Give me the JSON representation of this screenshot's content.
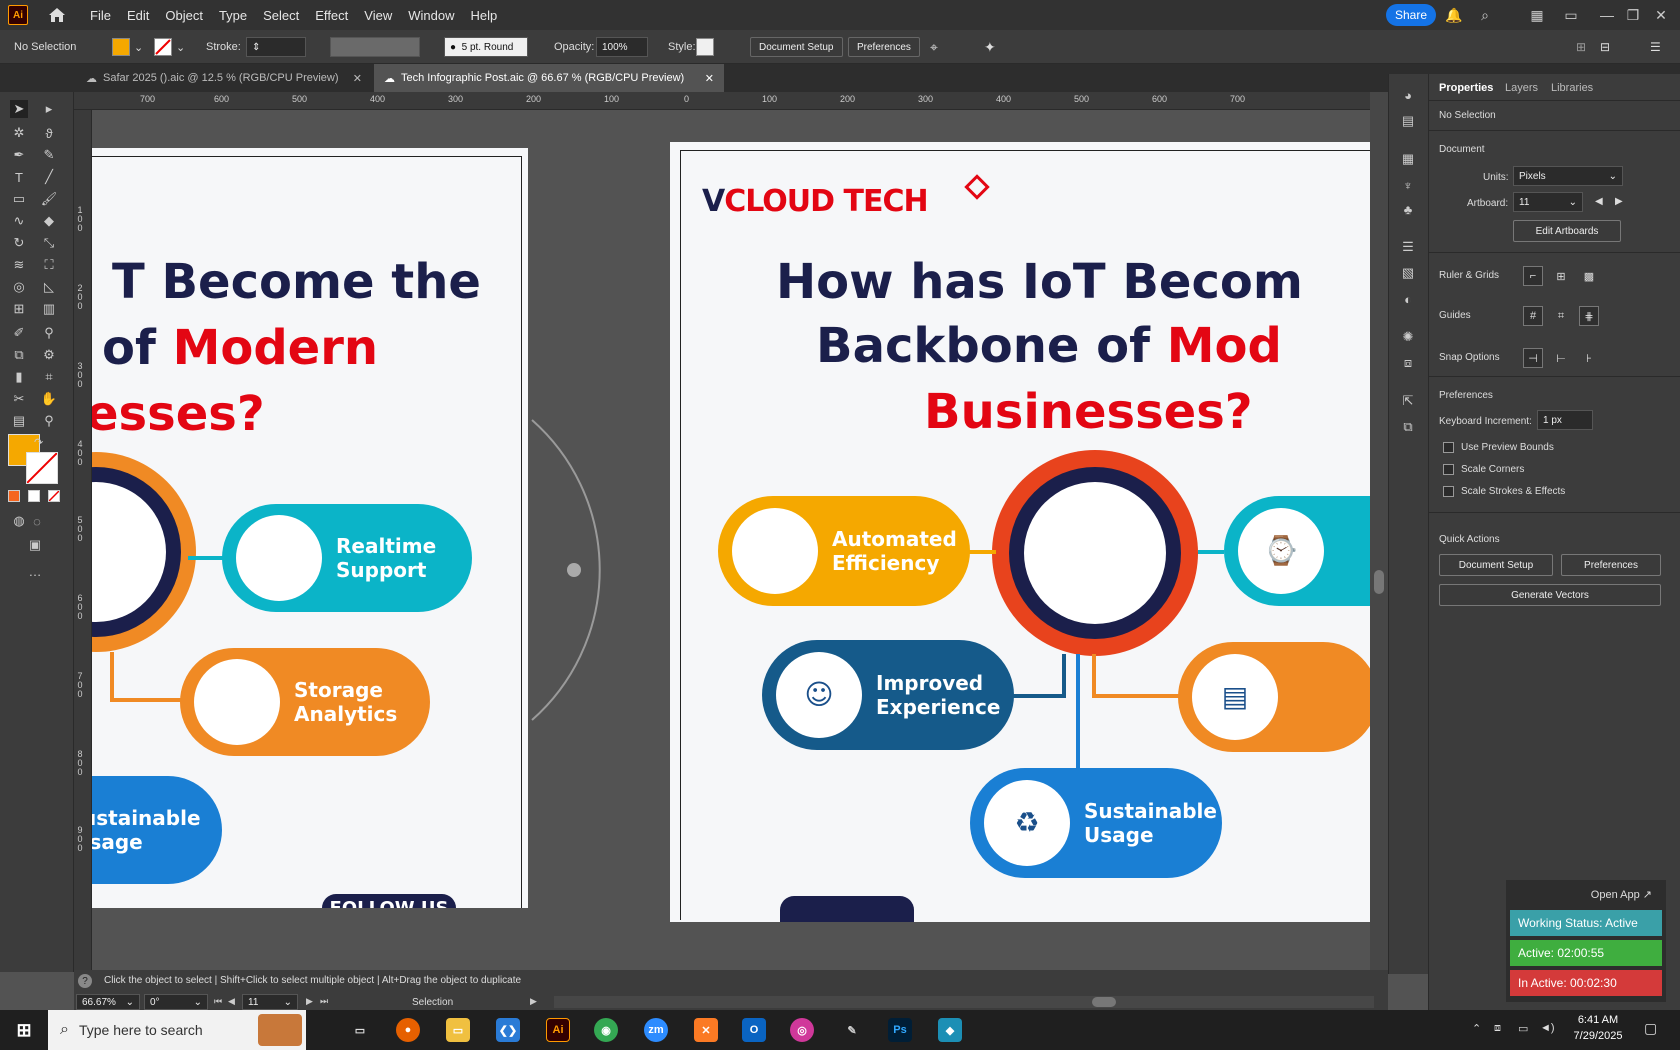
{
  "app": {
    "logo": "Ai",
    "menu": [
      "File",
      "Edit",
      "Object",
      "Type",
      "Select",
      "Effect",
      "View",
      "Window",
      "Help"
    ],
    "share": "Share"
  },
  "control": {
    "selection": "No Selection",
    "stroke_label": "Stroke:",
    "brush": "5 pt. Round",
    "opacity_label": "Opacity:",
    "opacity": "100%",
    "style_label": "Style:",
    "doc_setup": "Document Setup",
    "preferences": "Preferences",
    "fill_color": "#f5a800"
  },
  "tabs": [
    {
      "label": "Safar 2025 ().aic @ 12.5 % (RGB/CPU Preview)"
    },
    {
      "label": "Tech Infographic Post.aic @ 66.67 % (RGB/CPU Preview)"
    }
  ],
  "ruler": {
    "h": [
      "700",
      "600",
      "500",
      "400",
      "300",
      "200",
      "100",
      "0",
      "100",
      "200",
      "300",
      "400",
      "500",
      "600",
      "700"
    ],
    "v": [
      "1 0 0",
      "2 0 0",
      "3 0 0",
      "4 0 0",
      "5 0 0",
      "6 0 0",
      "7 0 0",
      "8 0 0",
      "9 0 0"
    ]
  },
  "left_art": {
    "line1": "T Become the",
    "line2a": "of ",
    "line2b": "Modern",
    "line3": "esses?",
    "pill1": "Realtime Support",
    "pill2": "Storage Analytics",
    "pill3": "ustainable Isage",
    "follow": "FOLLOW US"
  },
  "right_art": {
    "logo_v": "V",
    "logo_rest": "CLOUD TECH",
    "line1": "How has IoT Becom",
    "line2a": "Backbone of ",
    "line2b": "Mod",
    "line3": "Businesses?",
    "pill_auto": "Automated Efficiency",
    "pill_improved": "Improved Experience",
    "pill_sustain": "Sustainable Usage"
  },
  "props": {
    "tabs": [
      "Properties",
      "Layers",
      "Libraries"
    ],
    "no_selection": "No Selection",
    "document": "Document",
    "units_label": "Units:",
    "units": "Pixels",
    "artboard_label": "Artboard:",
    "artboard": "11",
    "edit_artboards": "Edit Artboards",
    "ruler_grids": "Ruler & Grids",
    "guides": "Guides",
    "snap_options": "Snap Options",
    "preferences": "Preferences",
    "keyboard_inc_label": "Keyboard Increment:",
    "keyboard_inc": "1 px",
    "use_preview_bounds": "Use Preview Bounds",
    "scale_corners": "Scale Corners",
    "scale_strokes": "Scale Strokes & Effects",
    "quick_actions": "Quick Actions",
    "doc_setup": "Document Setup",
    "prefs_btn": "Preferences",
    "generate_vectors": "Generate Vectors"
  },
  "status": {
    "hint": "Click the object to select  |  Shift+Click to select multiple object  |  Alt+Drag the object to duplicate",
    "zoom": "66.67%",
    "rotate": "0°",
    "artboard": "11",
    "tool": "Selection"
  },
  "widget": {
    "open_app": "Open App ↗",
    "working": "Working Status: Active",
    "active": "Active: 02:00:55",
    "inactive": "In Active: 00:02:30"
  },
  "taskbar": {
    "search": "Type here to search",
    "time": "6:41 AM",
    "date": "7/29/2025"
  }
}
